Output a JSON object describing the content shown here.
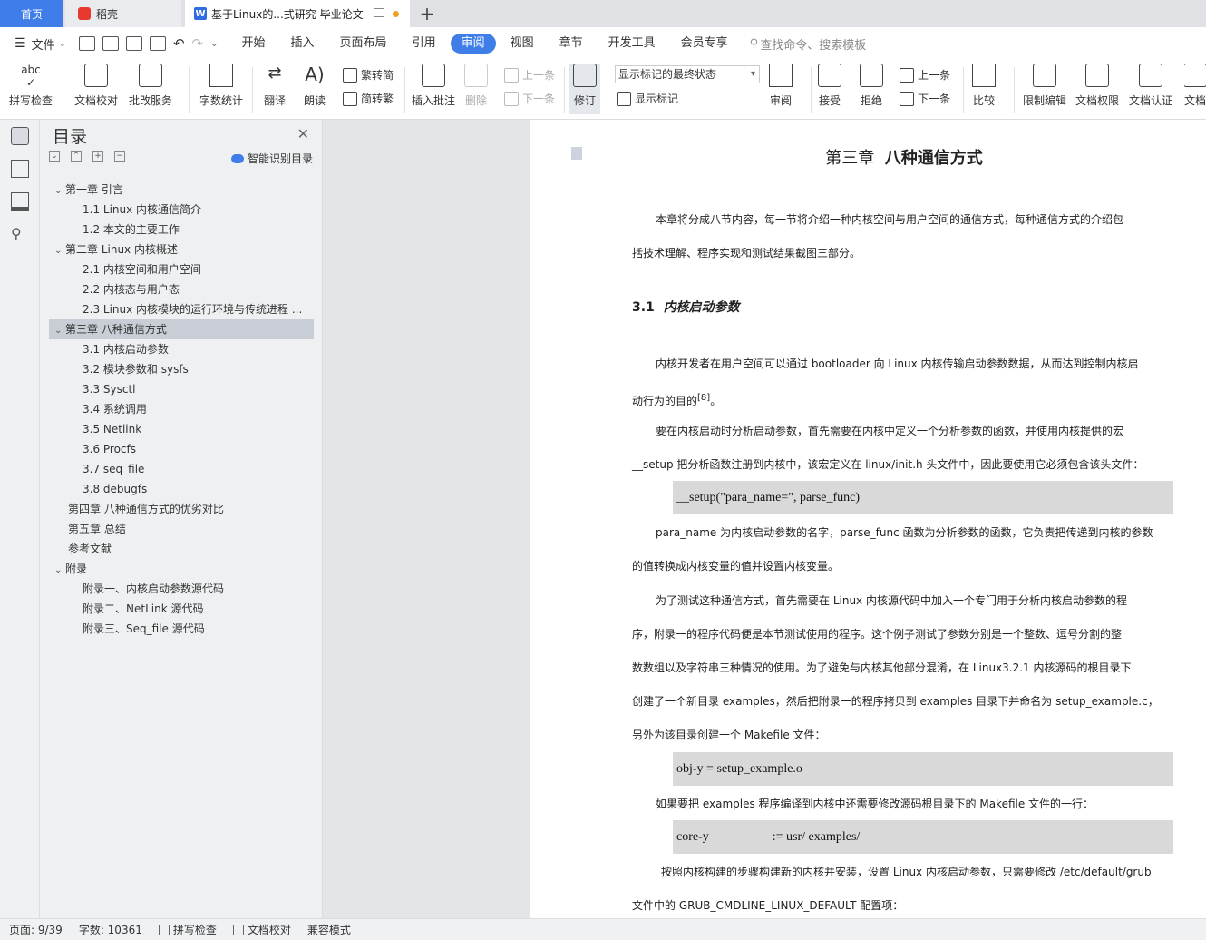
{
  "tabs": {
    "home": "首页",
    "app": "稻壳",
    "doc": "基于Linux的...式研究 毕业论文",
    "new": "+"
  },
  "menu": {
    "file": "文件",
    "items": [
      "开始",
      "插入",
      "页面布局",
      "引用",
      "审阅",
      "视图",
      "章节",
      "开发工具",
      "会员专享"
    ],
    "search": "查找命令、搜索模板"
  },
  "ribbon": {
    "spell": "拼写检查",
    "proof": "文档校对",
    "annot_service": "批改服务",
    "word_count": "字数统计",
    "translate": "翻译",
    "read_aloud": "朗读",
    "t2s": "繁转简",
    "s2t": "简转繁",
    "insert_comment": "插入批注",
    "delete": "删除",
    "prev_comment": "上一条",
    "next_comment": "下一条",
    "track": "修订",
    "markup_state": "显示标记的最终状态",
    "show_markup": "显示标记",
    "review": "审阅",
    "accept": "接受",
    "reject": "拒绝",
    "prev_change": "上一条",
    "next_change": "下一条",
    "compare": "比较",
    "restrict": "限制编辑",
    "doc_perm": "文档权限",
    "doc_cert": "文档认证",
    "doc_more": "文档"
  },
  "toc": {
    "title": "目录",
    "smart": "智能识别目录",
    "items": [
      {
        "text": "第一章 引言",
        "level": 0,
        "arrow": "⌄"
      },
      {
        "text": "1.1 Linux 内核通信简介",
        "level": 1
      },
      {
        "text": "1.2  本文的主要工作",
        "level": 1
      },
      {
        "text": "第二章  Linux 内核概述",
        "level": 0,
        "arrow": "⌄"
      },
      {
        "text": "2.1  内核空间和用户空间",
        "level": 1
      },
      {
        "text": "2.2  内核态与用户态",
        "level": 1
      },
      {
        "text": "2.3 Linux  内核模块的运行环境与传统进程 ...",
        "level": 1
      },
      {
        "text": "第三章  八种通信方式",
        "level": 0,
        "arrow": "⌄",
        "selected": true
      },
      {
        "text": "3.1  内核启动参数",
        "level": 1
      },
      {
        "text": "3.2  模块参数和 sysfs",
        "level": 1
      },
      {
        "text": "3.3 Sysctl",
        "level": 1
      },
      {
        "text": "3.4  系统调用",
        "level": 1
      },
      {
        "text": "3.5 Netlink",
        "level": 1
      },
      {
        "text": "3.6 Procfs",
        "level": 1
      },
      {
        "text": "3.7 seq_file",
        "level": 1
      },
      {
        "text": "3.8 debugfs",
        "level": 1
      },
      {
        "text": "第四章  八种通信方式的优劣对比",
        "level": 0
      },
      {
        "text": "第五章  总结",
        "level": 0
      },
      {
        "text": "参考文献",
        "level": 0
      },
      {
        "text": "附录",
        "level": 0,
        "arrow": "⌄"
      },
      {
        "text": "附录一、内核启动参数源代码",
        "level": 1
      },
      {
        "text": "附录二、NetLink  源代码",
        "level": 1
      },
      {
        "text": "附录三、Seq_file  源代码",
        "level": 1
      }
    ]
  },
  "doc": {
    "chapter_title": "第三章",
    "chapter_name": "八种通信方式",
    "intro_l1": "本章将分成八节内容，每一节将介绍一种内核空间与用户空间的通信方式，每种通信方式的介绍包",
    "intro_l2": "括技术理解、程序实现和测试结果截图三部分。",
    "sec_num": "3.1",
    "sec_name": "内核启动参数",
    "p1_l1": "内核开发者在用户空间可以通过  bootloader 向 Linux 内核传输启动参数数据，从而达到控制内核启",
    "p1_l2": "动行为的目的",
    "p1_ref": "[8]",
    "p2_l1": "要在内核启动时分析启动参数，首先需要在内核中定义一个分析参数的函数，并使用内核提供的宏",
    "p2_l2": "__setup 把分析函数注册到内核中，该宏定义在  linux/init.h  头文件中，因此要使用它必须包含该头文件：",
    "code1": "__setup(\"para_name=\", parse_func)",
    "p3_l1": "para_name 为内核启动参数的名字，parse_func 函数为分析参数的函数，它负责把传递到内核的参数",
    "p3_l2": "的值转换成内核变量的值并设置内核变量。",
    "p4_l1": "为了测试这种通信方式，首先需要在 Linux 内核源代码中加入一个专门用于分析内核启动参数的程",
    "p4_l2": "序，附录一的程序代码便是本节测试使用的程序。这个例子测试了参数分别是一个整数、逗号分割的整",
    "p4_l3": "数数组以及字符串三种情况的使用。为了避免与内核其他部分混淆，在 Linux3.2.1 内核源码的根目录下",
    "p4_l4": "创建了一个新目录  examples，然后把附录一的程序拷贝到  examples  目录下并命名为  setup_example.c，",
    "p4_l5": "另外为该目录创建一个  Makefile  文件：",
    "code2": "obj-y = setup_example.o",
    "p5": "如果要把 examples 程序编译到内核中还需要修改源码根目录下的  Makefile 文件的一行：",
    "code3": "core-y                    := usr/ examples/",
    "p6_l1": "按照内核构建的步骤构建新的内核并安装，设置 Linux 内核启动参数，只需要修改  /etc/default/grub",
    "p6_l2": "文件中的 GRUB_CMDLINE_LINUX_DEFAULT 配置项："
  },
  "status": {
    "page": "页面: 9/39",
    "words": "字数: 10361",
    "spell": "拼写检查",
    "proof": "文档校对",
    "compat": "兼容模式"
  },
  "colors": {
    "accent": "#3f7ee8",
    "selected_toc": "#c9ced6",
    "code_bg": "#d9d9d9"
  }
}
